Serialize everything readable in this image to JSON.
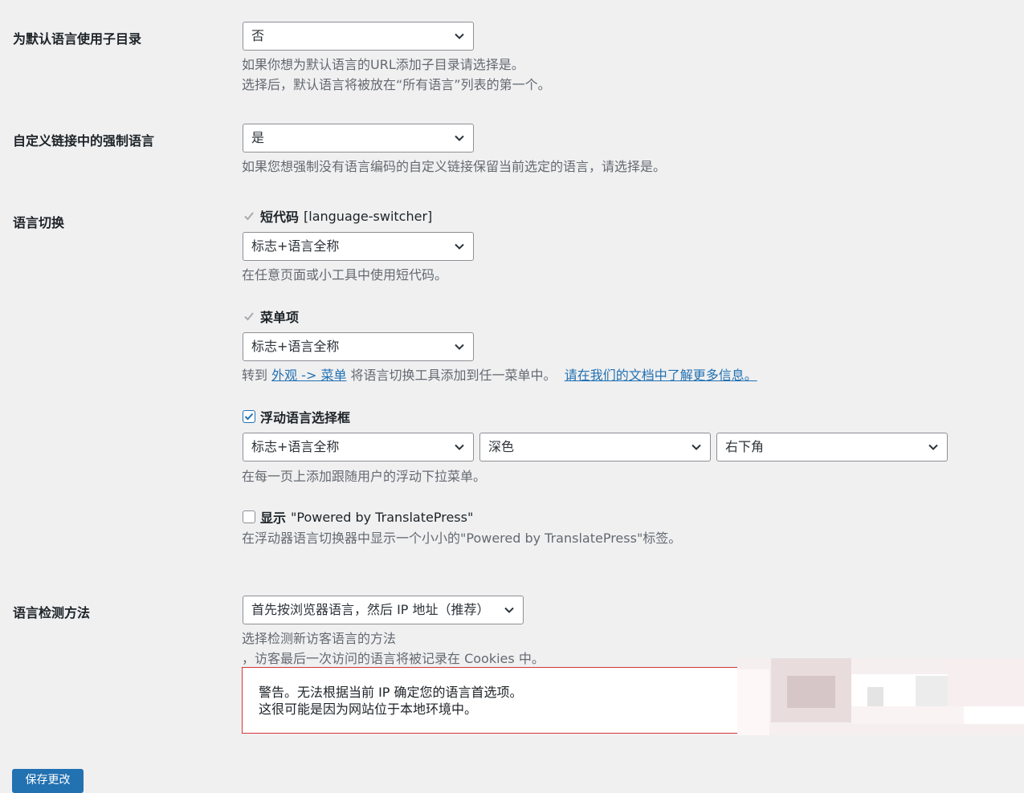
{
  "subdirectory": {
    "label": "为默认语言使用子目录",
    "value": "否",
    "desc_line1": "如果你想为默认语言的URL添加子目录请选择是。",
    "desc_line2": "选择后，默认语言将被放在“所有语言”列表的第一个。"
  },
  "force_language": {
    "label": "自定义链接中的强制语言",
    "value": "是",
    "desc": "如果您想强制没有语言编码的自定义链接保留当前选定的语言，请选择是。"
  },
  "language_switcher": {
    "label": "语言切换",
    "shortcode": {
      "title": "短代码",
      "code": "[language-switcher]",
      "value": "标志+语言全称",
      "desc": "在任意页面或小工具中使用短代码。"
    },
    "menu": {
      "title": "菜单项",
      "value": "标志+语言全称",
      "desc_prefix": "转到 ",
      "desc_link": "外观 -> 菜单",
      "desc_middle": " 将语言切换工具添加到任一菜单中。  ",
      "desc_doc_link": "请在我们的文档中了解更多信息。"
    },
    "floating": {
      "title": "浮动语言选择框",
      "checked": true,
      "value_style": "标志+语言全称",
      "value_theme": "深色",
      "value_position": "右下角",
      "desc": "在每一页上添加跟随用户的浮动下拉菜单。"
    },
    "powered_by": {
      "title": "显示",
      "title_rest": "\"Powered by TranslatePress\"",
      "checked": false,
      "desc": "在浮动器语言切换器中显示一个小小的\"Powered by TranslatePress\"标签。"
    }
  },
  "detection": {
    "label": "语言检测方法",
    "value": "首先按浏览器语言，然后 IP 地址（推荐）",
    "desc_line1": "选择检测新访客语言的方法",
    "desc_line2": "，访客最后一次访问的语言将被记录在 Cookies 中。",
    "warning_line1": "警告。无法根据当前 IP 确定您的语言首选项。",
    "warning_line2": "这很可能是因为网站位于本地环境中。"
  },
  "save_button": "保存更改",
  "colors": {
    "accent": "#2271b1",
    "error": "#d63638",
    "background": "#f0f0f1"
  },
  "icons": {
    "select_arrow": "chevron-down-icon",
    "checkmark": "check-icon"
  }
}
